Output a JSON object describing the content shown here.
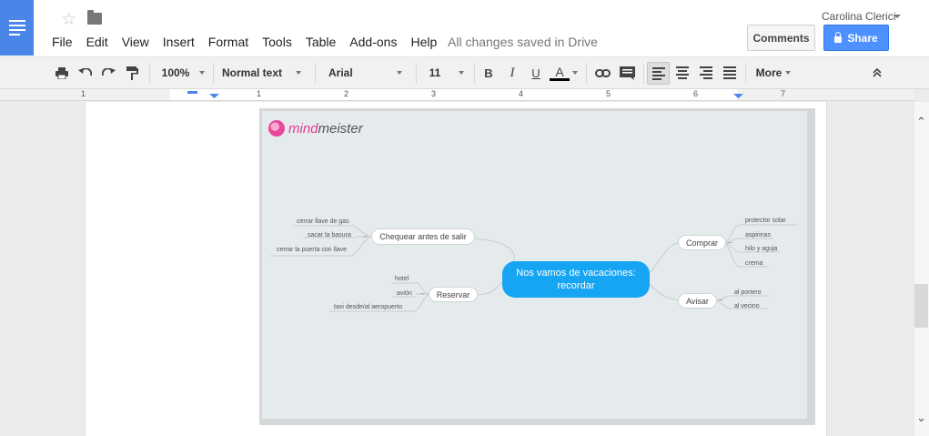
{
  "header": {
    "save_status": "All changes saved in Drive",
    "user": "Carolina Clerici",
    "comments_label": "Comments",
    "share_label": "Share",
    "menu": [
      "File",
      "Edit",
      "View",
      "Insert",
      "Format",
      "Tools",
      "Table",
      "Add-ons",
      "Help"
    ]
  },
  "toolbar": {
    "zoom": "100%",
    "style": "Normal text",
    "font": "Arial",
    "size": "11",
    "bold": "B",
    "italic": "I",
    "underline": "U",
    "text_color": "A",
    "more_label": "More"
  },
  "ruler": [
    "1",
    "1",
    "2",
    "3",
    "4",
    "5",
    "6",
    "7"
  ],
  "mindmap": {
    "logo_part1": "mind",
    "logo_part2": "meister",
    "root_line1": "Nos vamos de vacaciones:",
    "root_line2": "recordar",
    "branches": {
      "check": "Chequear antes de salir",
      "reserve": "Reservar",
      "buy": "Comprar",
      "notify": "Avisar"
    },
    "check_items": [
      "cerrar llave de gas",
      "sacar la basura",
      "cerrar la puerta con llave"
    ],
    "reserve_items": [
      "hotel",
      "avión",
      "taxi desde/al aeropuerto"
    ],
    "buy_items": [
      "protector solar",
      "aspirinas",
      "hilo y aguja",
      "crema"
    ],
    "notify_items": [
      "al portero",
      "al vecino"
    ]
  },
  "colors": {
    "accent": "#4a86e8",
    "share": "#4d90fe",
    "root_node": "#15a5f3",
    "canvas": "#e5eaed"
  }
}
